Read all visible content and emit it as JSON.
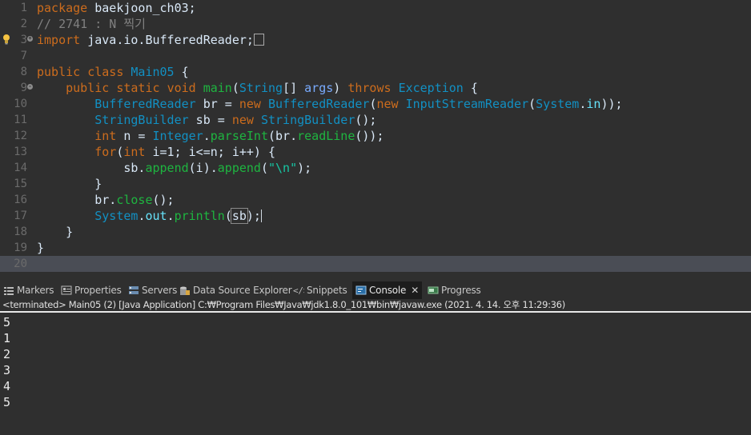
{
  "editor": {
    "lines": [
      {
        "num": "1",
        "segments": [
          {
            "t": "package",
            "c": "kw"
          },
          {
            "t": " baekjoon_ch03;",
            "c": ""
          }
        ]
      },
      {
        "num": "2",
        "segments": [
          {
            "t": "// 2741 : N 찍기",
            "c": "cmt"
          }
        ]
      },
      {
        "num": "3",
        "fold": "+",
        "bulb": true,
        "segments": [
          {
            "t": "import",
            "c": "kw"
          },
          {
            "t": " java.io.BufferedReader;",
            "c": ""
          }
        ],
        "box": true
      },
      {
        "num": "7",
        "segments": []
      },
      {
        "num": "8",
        "segments": [
          {
            "t": "public",
            "c": "kw"
          },
          {
            "t": " ",
            "c": ""
          },
          {
            "t": "class",
            "c": "kw"
          },
          {
            "t": " ",
            "c": ""
          },
          {
            "t": "Main05",
            "c": "cls"
          },
          {
            "t": " {",
            "c": ""
          }
        ]
      },
      {
        "num": "9",
        "fold": "-",
        "segments": [
          {
            "t": "    ",
            "c": ""
          },
          {
            "t": "public",
            "c": "kw"
          },
          {
            "t": " ",
            "c": ""
          },
          {
            "t": "static",
            "c": "kw"
          },
          {
            "t": " ",
            "c": ""
          },
          {
            "t": "void",
            "c": "kw"
          },
          {
            "t": " ",
            "c": ""
          },
          {
            "t": "main",
            "c": "mth"
          },
          {
            "t": "(",
            "c": ""
          },
          {
            "t": "String",
            "c": "cls"
          },
          {
            "t": "[] ",
            "c": ""
          },
          {
            "t": "args",
            "c": "var"
          },
          {
            "t": ") ",
            "c": ""
          },
          {
            "t": "throws",
            "c": "kw"
          },
          {
            "t": " ",
            "c": ""
          },
          {
            "t": "Exception",
            "c": "cls"
          },
          {
            "t": " {",
            "c": ""
          }
        ]
      },
      {
        "num": "10",
        "segments": [
          {
            "t": "        ",
            "c": ""
          },
          {
            "t": "BufferedReader",
            "c": "cls"
          },
          {
            "t": " br = ",
            "c": ""
          },
          {
            "t": "new",
            "c": "kw"
          },
          {
            "t": " ",
            "c": ""
          },
          {
            "t": "BufferedReader",
            "c": "cls"
          },
          {
            "t": "(",
            "c": ""
          },
          {
            "t": "new",
            "c": "kw"
          },
          {
            "t": " ",
            "c": ""
          },
          {
            "t": "InputStreamReader",
            "c": "cls"
          },
          {
            "t": "(",
            "c": ""
          },
          {
            "t": "System",
            "c": "cls"
          },
          {
            "t": ".",
            "c": ""
          },
          {
            "t": "in",
            "c": "fld"
          },
          {
            "t": "));",
            "c": ""
          }
        ]
      },
      {
        "num": "11",
        "segments": [
          {
            "t": "        ",
            "c": ""
          },
          {
            "t": "StringBuilder",
            "c": "cls"
          },
          {
            "t": " sb = ",
            "c": ""
          },
          {
            "t": "new",
            "c": "kw"
          },
          {
            "t": " ",
            "c": ""
          },
          {
            "t": "StringBuilder",
            "c": "cls"
          },
          {
            "t": "();",
            "c": ""
          }
        ]
      },
      {
        "num": "12",
        "segments": [
          {
            "t": "        ",
            "c": ""
          },
          {
            "t": "int",
            "c": "kw"
          },
          {
            "t": " n = ",
            "c": ""
          },
          {
            "t": "Integer",
            "c": "cls"
          },
          {
            "t": ".",
            "c": ""
          },
          {
            "t": "parseInt",
            "c": "mth"
          },
          {
            "t": "(br.",
            "c": ""
          },
          {
            "t": "readLine",
            "c": "mth"
          },
          {
            "t": "());",
            "c": ""
          }
        ]
      },
      {
        "num": "13",
        "segments": [
          {
            "t": "        ",
            "c": ""
          },
          {
            "t": "for",
            "c": "kw"
          },
          {
            "t": "(",
            "c": ""
          },
          {
            "t": "int",
            "c": "kw"
          },
          {
            "t": " i=1; i<=n; i++) {",
            "c": ""
          }
        ]
      },
      {
        "num": "14",
        "segments": [
          {
            "t": "            sb.",
            "c": ""
          },
          {
            "t": "append",
            "c": "mth"
          },
          {
            "t": "(i).",
            "c": ""
          },
          {
            "t": "append",
            "c": "mth"
          },
          {
            "t": "(",
            "c": ""
          },
          {
            "t": "\"\\n\"",
            "c": "str"
          },
          {
            "t": ");",
            "c": ""
          }
        ]
      },
      {
        "num": "15",
        "segments": [
          {
            "t": "        }",
            "c": ""
          }
        ]
      },
      {
        "num": "16",
        "segments": [
          {
            "t": "        br.",
            "c": ""
          },
          {
            "t": "close",
            "c": "mth"
          },
          {
            "t": "();",
            "c": ""
          }
        ]
      },
      {
        "num": "17",
        "segments": [
          {
            "t": "        ",
            "c": ""
          },
          {
            "t": "System",
            "c": "cls"
          },
          {
            "t": ".",
            "c": ""
          },
          {
            "t": "out",
            "c": "fld"
          },
          {
            "t": ".",
            "c": ""
          },
          {
            "t": "println",
            "c": "mth"
          },
          {
            "t": "(",
            "c": ""
          },
          {
            "t": "sb",
            "c": "hl"
          },
          {
            "t": ");",
            "c": ""
          }
        ],
        "caret": true
      },
      {
        "num": "18",
        "segments": [
          {
            "t": "    }",
            "c": ""
          }
        ]
      },
      {
        "num": "19",
        "segments": [
          {
            "t": "}",
            "c": ""
          }
        ]
      },
      {
        "num": "20",
        "segments": [],
        "current": true
      }
    ]
  },
  "panel": {
    "tabs": [
      {
        "name": "markers",
        "label": "Markers",
        "icon": "markers-icon",
        "active": false
      },
      {
        "name": "properties",
        "label": "Properties",
        "icon": "properties-icon",
        "active": false
      },
      {
        "name": "servers",
        "label": "Servers",
        "icon": "servers-icon",
        "active": false
      },
      {
        "name": "data-source-explorer",
        "label": "Data Source Explorer",
        "icon": "database-icon",
        "active": false
      },
      {
        "name": "snippets",
        "label": "Snippets",
        "icon": "snippets-icon",
        "active": false
      },
      {
        "name": "console",
        "label": "Console",
        "icon": "console-icon",
        "active": true,
        "close": "✕"
      },
      {
        "name": "progress",
        "label": "Progress",
        "icon": "progress-icon",
        "active": false
      }
    ],
    "status": "<terminated> Main05 (2) [Java Application] C:₩Program Files₩Java₩jdk1.8.0_101₩bin₩javaw.exe (2021. 4. 14. 오후 11:29:36)",
    "output": [
      "5",
      "1",
      "2",
      "3",
      "4",
      "5"
    ]
  },
  "colors": {
    "editor_bg": "#2f2f2f",
    "current_line": "#4a4d55",
    "keyword": "#cc6c1d",
    "class": "#1290c3",
    "method": "#1eb540",
    "string": "#17c6a3",
    "comment": "#808080"
  }
}
